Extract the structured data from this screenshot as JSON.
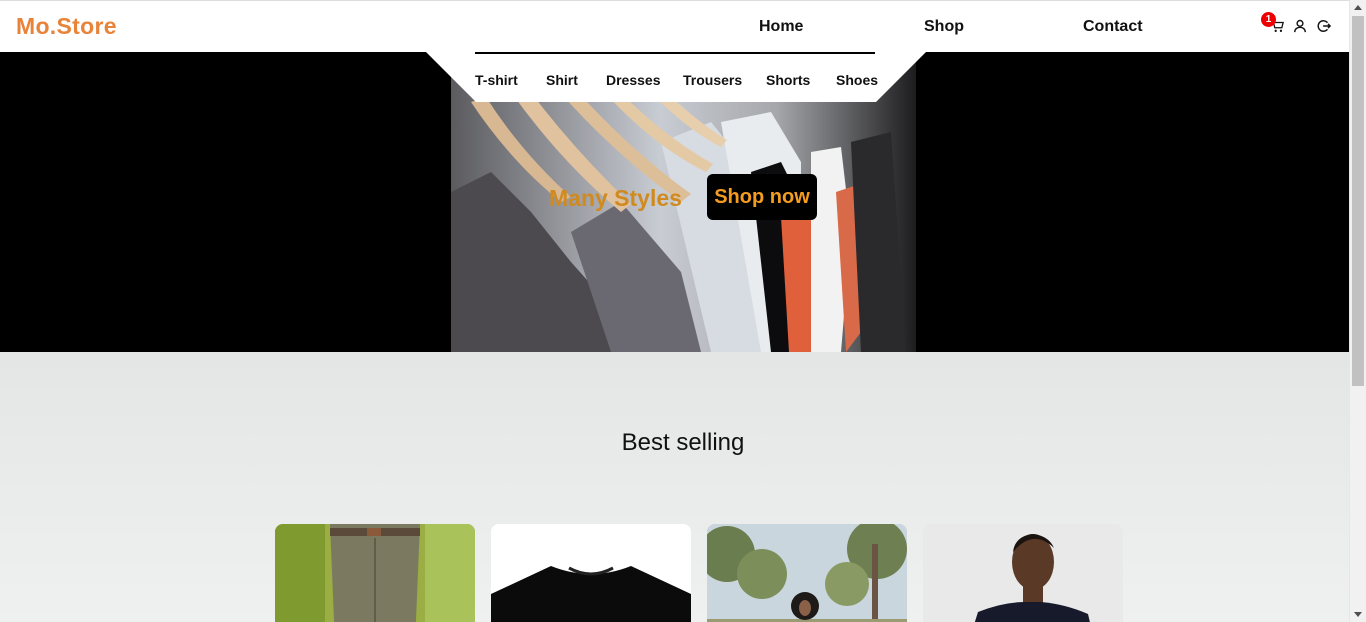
{
  "header": {
    "logo": "Mo.Store",
    "nav": {
      "home": "Home",
      "shop": "Shop",
      "contact": "Contact"
    },
    "cart_count": "1"
  },
  "subnav": [
    "T-shirt",
    "Shirt",
    "Dresses",
    "Trousers",
    "Shorts",
    "Shoes"
  ],
  "hero": {
    "headline": "Many Styles",
    "cta": "Shop now"
  },
  "best_selling": {
    "title": "Best selling",
    "products": [
      {
        "image": "khaki-trousers"
      },
      {
        "image": "black-tshirt"
      },
      {
        "image": "woman-outdoors"
      },
      {
        "image": "man-tshirt"
      }
    ]
  },
  "colors": {
    "brand": "#e8833a",
    "badge": "#ee0000",
    "cta_text": "#f39c20",
    "section_bg": "#e4e6e6"
  }
}
